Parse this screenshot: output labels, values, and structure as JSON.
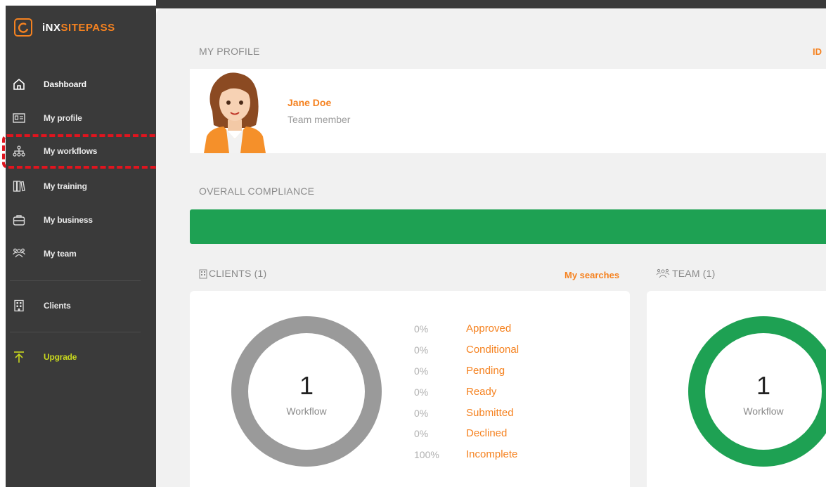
{
  "brand": {
    "inx": "iNX",
    "site": "SITEPASS",
    "accent": "#f58220"
  },
  "sidebar": {
    "items": [
      {
        "label": "Dashboard",
        "icon": "home-icon"
      },
      {
        "label": "My profile",
        "icon": "id-card-icon"
      },
      {
        "label": "My workflows",
        "icon": "workflow-icon"
      },
      {
        "label": "My training",
        "icon": "books-icon"
      },
      {
        "label": "My business",
        "icon": "briefcase-icon"
      },
      {
        "label": "My team",
        "icon": "team-icon"
      },
      {
        "label": "Clients",
        "icon": "building-icon"
      },
      {
        "label": "Upgrade",
        "icon": "upgrade-arrow-icon"
      }
    ]
  },
  "profile": {
    "section_title": "MY PROFILE",
    "id_link": "ID",
    "name": "Jane Doe",
    "role": "Team member"
  },
  "compliance": {
    "section_title": "OVERALL COMPLIANCE",
    "bar_color": "#1ea153"
  },
  "clients": {
    "section_title": "CLIENTS (1)",
    "my_searches": "My searches",
    "count": "1",
    "count_label": "Workflow",
    "stats": [
      {
        "pct": "0%",
        "label": "Approved"
      },
      {
        "pct": "0%",
        "label": "Conditional"
      },
      {
        "pct": "0%",
        "label": "Pending"
      },
      {
        "pct": "0%",
        "label": "Ready"
      },
      {
        "pct": "0%",
        "label": "Submitted"
      },
      {
        "pct": "0%",
        "label": "Declined"
      },
      {
        "pct": "100%",
        "label": "Incomplete"
      }
    ]
  },
  "team": {
    "section_title": "TEAM (1)",
    "count": "1",
    "count_label": "Workflow"
  }
}
